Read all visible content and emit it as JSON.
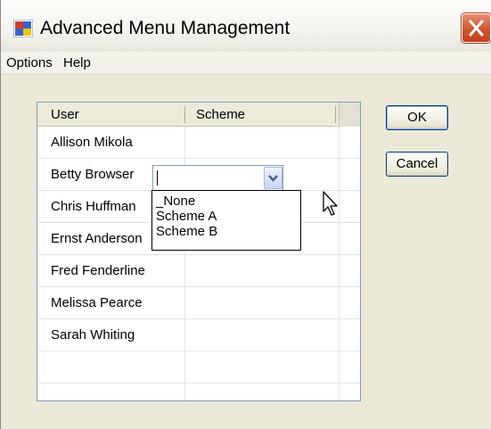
{
  "window": {
    "title": "Advanced Menu Management"
  },
  "menu": {
    "items": [
      "Options",
      "Help"
    ]
  },
  "grid": {
    "columns": [
      "User",
      "Scheme"
    ],
    "rows": [
      {
        "user": "Allison Mikola",
        "scheme": ""
      },
      {
        "user": "Betty Browser",
        "scheme": ""
      },
      {
        "user": "Chris Huffman",
        "scheme": ""
      },
      {
        "user": "Ernst Anderson",
        "scheme": ""
      },
      {
        "user": "Fred Fenderline",
        "scheme": ""
      },
      {
        "user": "Melissa Pearce",
        "scheme": ""
      },
      {
        "user": "Sarah Whiting",
        "scheme": ""
      }
    ]
  },
  "scheme_combo": {
    "value": "",
    "options": [
      "_None",
      "Scheme A",
      "Scheme B"
    ]
  },
  "buttons": {
    "ok": "OK",
    "cancel": "Cancel"
  },
  "icons": {
    "app": "window-app-icon",
    "close": "close-icon",
    "combo_arrow": "chevron-down-icon",
    "cursor": "mouse-pointer-icon"
  },
  "colors": {
    "close_button": "#d0542f",
    "button_border": "#003c74",
    "grid_border": "#7f9db9"
  }
}
